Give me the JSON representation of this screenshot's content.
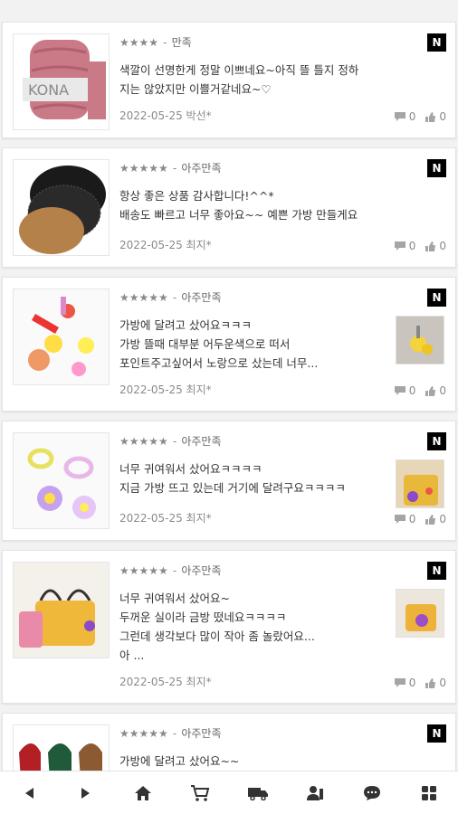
{
  "reviews": [
    {
      "stars": "★★★★",
      "sep": "-",
      "grade": "만족",
      "line1": "색깔이 선명한게 정말 이쁘네요~아직 뜰 틀지 정하",
      "line2": "지는 않았지만 이쁠거같네요~♡",
      "line3": "",
      "line4": "",
      "date_author": "2022-05-25 박선*",
      "comments": "0",
      "likes": "0",
      "badge": "N"
    },
    {
      "stars": "★★★★★",
      "sep": "-",
      "grade": "아주만족",
      "line1": "항상 좋은 상품 감사합니다!^^*",
      "line2": "배송도 빠르고 너무 좋아요~~ 예쁜 가방 만들게요",
      "line3": "",
      "line4": "",
      "date_author": "2022-05-25 최지*",
      "comments": "0",
      "likes": "0",
      "badge": "N"
    },
    {
      "stars": "★★★★★",
      "sep": "-",
      "grade": "아주만족",
      "line1": "가방에 달려고 샀어요ㅋㅋㅋ",
      "line2": "가방 뜰때 대부분 어두운색으로 떠서",
      "line3": "포인트주고싶어서 노랑으로 샀는데 너무...",
      "line4": "",
      "date_author": "2022-05-25 최지*",
      "comments": "0",
      "likes": "0",
      "badge": "N"
    },
    {
      "stars": "★★★★★",
      "sep": "-",
      "grade": "아주만족",
      "line1": "너무 귀여워서 샀어요ㅋㅋㅋㅋ",
      "line2": "지금 가방 뜨고 있는데 거기에 달려구요ㅋㅋㅋㅋ",
      "line3": "",
      "line4": "",
      "date_author": "2022-05-25 최지*",
      "comments": "0",
      "likes": "0",
      "badge": "N"
    },
    {
      "stars": "★★★★★",
      "sep": "-",
      "grade": "아주만족",
      "line1": "너무 귀여워서 샀어요~",
      "line2": "두꺼운 실이라 금방 떴네요ㅋㅋㅋㅋ",
      "line3": "그런데 생각보다 많이 작아 좀 놀랐어요...",
      "line4": "아 ...",
      "date_author": "2022-05-25 최지*",
      "comments": "0",
      "likes": "0",
      "badge": "N"
    },
    {
      "stars": "★★★★★",
      "sep": "-",
      "grade": "아주만족",
      "line1": "가방에 달려고 샀어요~~",
      "line2": "",
      "line3": "",
      "line4": "",
      "date_author": "",
      "comments": "",
      "likes": "",
      "badge": "N"
    }
  ],
  "product_icon_names": [
    "yarn-ball-image",
    "leather-base-image",
    "keyring-image",
    "flower-keyring-image",
    "knit-bag-image",
    "scarf-image"
  ],
  "nav": {
    "items": [
      "back",
      "forward",
      "home",
      "cart",
      "delivery",
      "mypage",
      "chat",
      "menu"
    ]
  },
  "colors": {
    "badge": "#000000",
    "text": "#333333",
    "muted": "#8a8a8a"
  }
}
